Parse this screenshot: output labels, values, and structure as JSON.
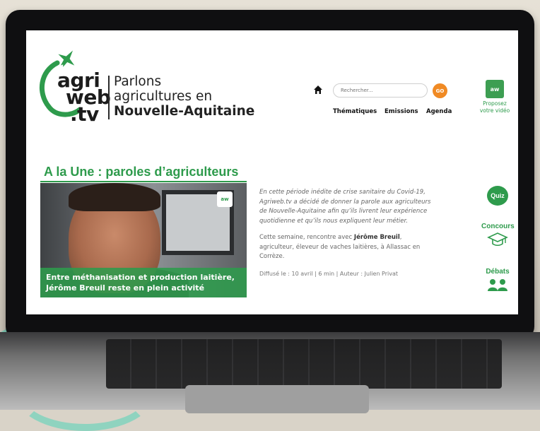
{
  "brand": {
    "logo_words": [
      "agri",
      "web",
      ".tv"
    ],
    "tagline_lines": [
      "Parlons",
      "agricultures en",
      "Nouvelle-Aquitaine"
    ],
    "green": "#2e9b4c",
    "orange": "#f08a24"
  },
  "header": {
    "search_placeholder": "Rechercher...",
    "go_label": "GO",
    "nav": [
      "Thématiques",
      "Emissions",
      "Agenda"
    ],
    "propose_badge": "aw",
    "propose_label": "Proposez votre vidéo"
  },
  "une": {
    "title": "A la Une",
    "subtitle": " : paroles d’agriculteurs",
    "video_logo": "aw",
    "video_caption": "Entre méthanisation et production laitière, Jérôme Breuil reste en plein activité",
    "intro": "En cette période inédite de crise sanitaire du Covid-19, Agriweb.tv a décidé de donner la parole aux agriculteurs de Nouvelle-Aquitaine afin qu’ils livrent leur expérience quotidienne et qu’ils nous expliquent leur métier.",
    "body_before": "Cette semaine, rencontre avec ",
    "body_name": "Jérôme Breuil",
    "body_after": ", agriculteur, éleveur de vaches laitières, à Allassac en Corrèze.",
    "meta": "Diffusé le : 10 avril  | 6 min  |  Auteur : Julien Privat"
  },
  "side": {
    "quiz": "Quiz",
    "concours": "Concours",
    "debats": "Débats"
  },
  "icons": [
    "home-icon",
    "plane-icon",
    "graduation-cap-icon",
    "people-icon"
  ]
}
